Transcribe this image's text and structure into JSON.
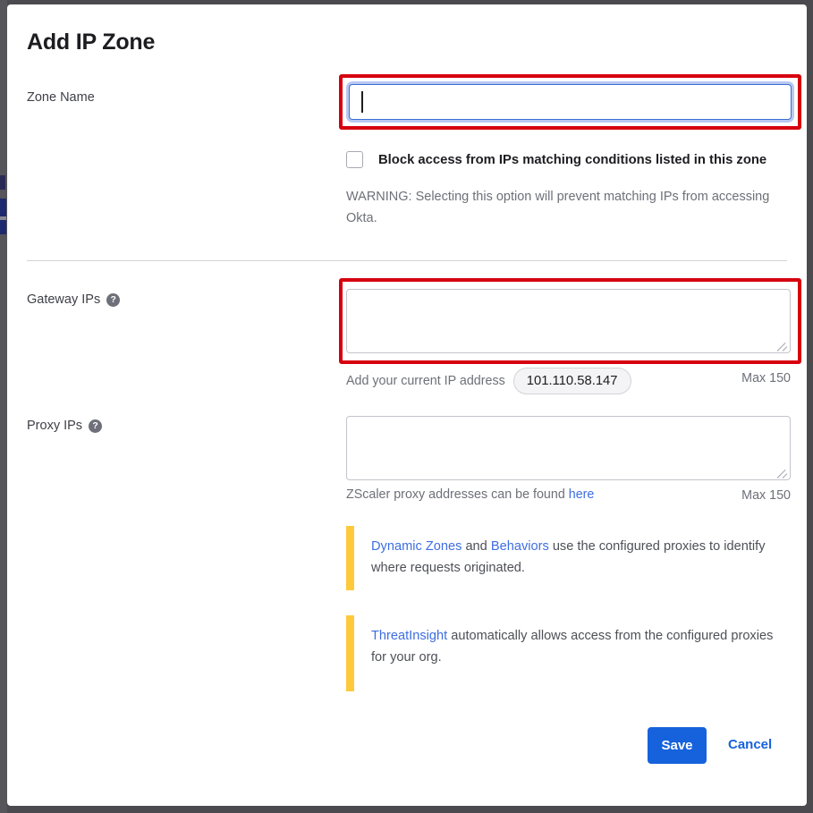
{
  "dialog": {
    "title": "Add IP Zone"
  },
  "zone_name": {
    "label": "Zone Name",
    "value": "",
    "placeholder": ""
  },
  "block_option": {
    "label": "Block access from IPs matching conditions listed in this zone",
    "checked": false,
    "warning": "WARNING: Selecting this option will prevent matching IPs from accessing Okta."
  },
  "gateway_ips": {
    "label": "Gateway IPs",
    "help_icon": "question-mark-icon",
    "value": "",
    "helper_text": "Add your current IP address",
    "current_ip": "101.110.58.147",
    "max_note": "Max 150"
  },
  "proxy_ips": {
    "label": "Proxy IPs",
    "help_icon": "question-mark-icon",
    "value": "",
    "helper_prefix": "ZScaler proxy addresses can be found ",
    "helper_link": "here",
    "max_note": "Max 150"
  },
  "callouts": [
    {
      "link_1": "Dynamic Zones",
      "mid_text": " and ",
      "link_2": "Behaviors",
      "rest_text": " use the configured proxies to identify where requests originated."
    },
    {
      "link_1": "ThreatInsight",
      "rest_text": " automatically allows access from the configured proxies for your org."
    }
  ],
  "footer": {
    "save_label": "Save",
    "cancel_label": "Cancel"
  },
  "colors": {
    "accent_blue": "#1662dd",
    "link_blue": "#3e6ee0",
    "callout_yellow": "#ffc93c",
    "annotation_red": "#d6000f",
    "focus_ring": "#b9c8f2",
    "text_muted": "#6e7079"
  }
}
